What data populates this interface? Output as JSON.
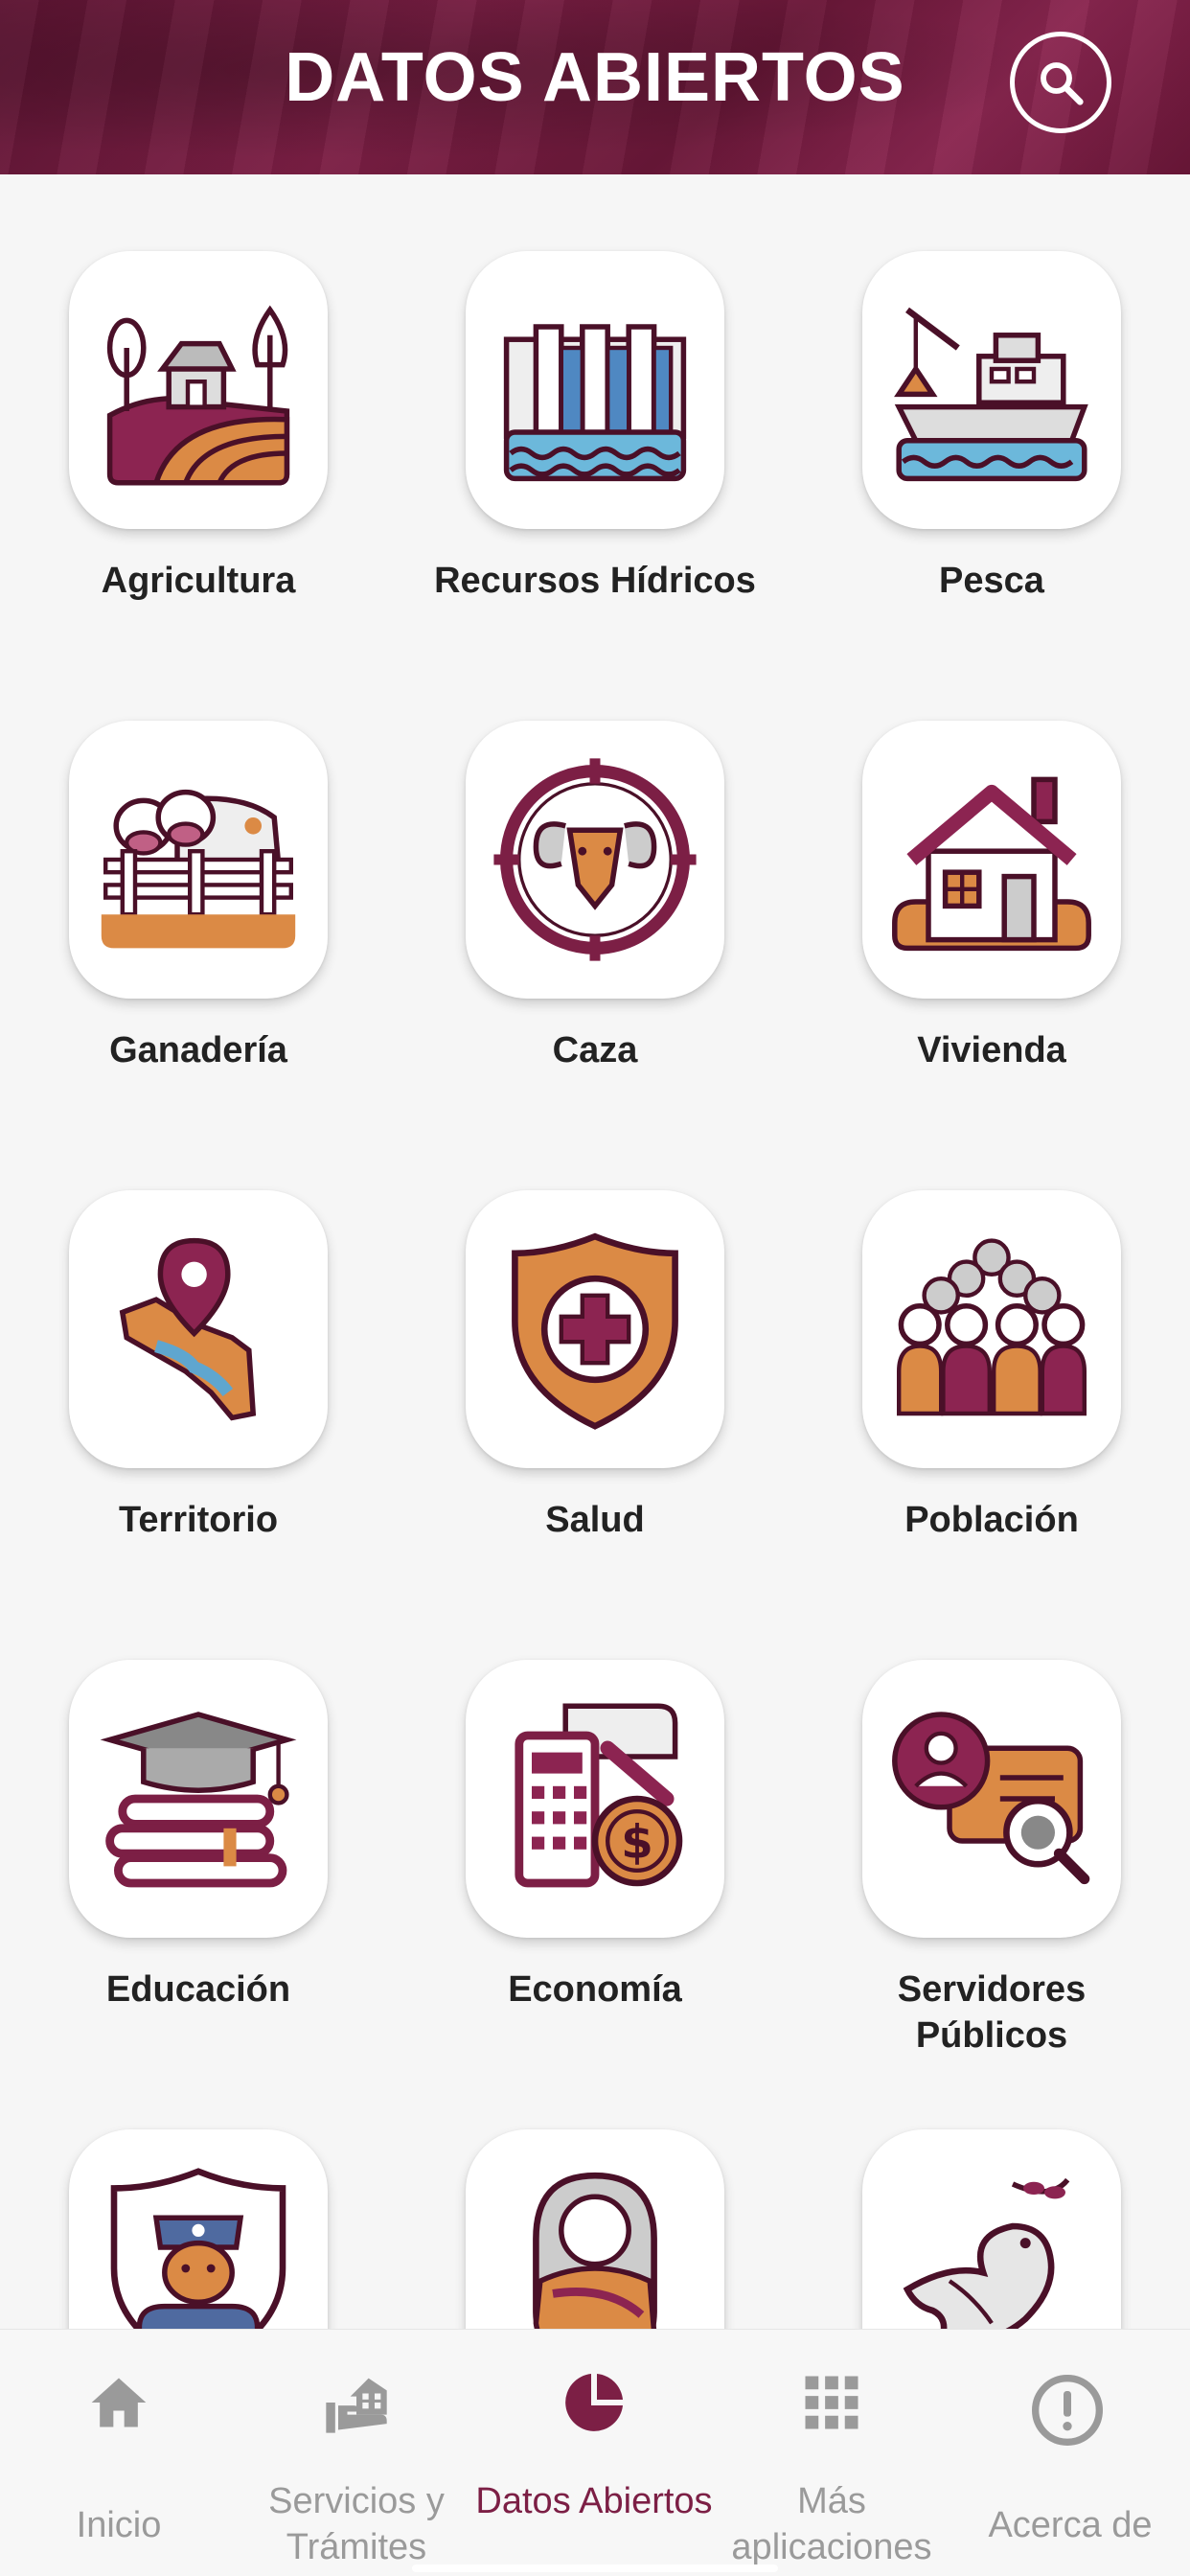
{
  "header": {
    "title": "DATOS ABIERTOS"
  },
  "colors": {
    "brand": "#7c1f45",
    "orange": "#db8a45",
    "blue": "#5fa6cf",
    "inactive": "#9a9a9a"
  },
  "categories": [
    {
      "label": "Agricultura",
      "icon": "farm-icon"
    },
    {
      "label": "Recursos Hídricos",
      "icon": "dam-icon"
    },
    {
      "label": "Pesca",
      "icon": "fishing-boat-icon"
    },
    {
      "label": "Ganadería",
      "icon": "cattle-icon"
    },
    {
      "label": "Caza",
      "icon": "ram-target-icon"
    },
    {
      "label": "Vivienda",
      "icon": "house-icon"
    },
    {
      "label": "Territorio",
      "icon": "map-pin-icon"
    },
    {
      "label": "Salud",
      "icon": "health-shield-icon"
    },
    {
      "label": "Población",
      "icon": "crowd-icon"
    },
    {
      "label": "Educación",
      "icon": "graduation-books-icon"
    },
    {
      "label": "Economía",
      "icon": "calculator-coin-icon"
    },
    {
      "label": "Servidores Públicos",
      "icon": "id-card-search-icon"
    },
    {
      "label": "",
      "icon": "police-shield-icon"
    },
    {
      "label": "",
      "icon": "baby-icon"
    },
    {
      "label": "",
      "icon": "peace-dove-icon"
    }
  ],
  "nav": {
    "items": [
      {
        "label": "Inicio",
        "icon": "home-icon"
      },
      {
        "label": "Servicios y Trámites",
        "icon": "hand-building-icon"
      },
      {
        "label": "Datos Abiertos",
        "icon": "pie-chart-icon"
      },
      {
        "label": "Más aplicaciones",
        "icon": "grid-icon"
      },
      {
        "label": "Acerca de",
        "icon": "info-exclamation-icon"
      }
    ],
    "active": "Datos Abiertos"
  }
}
